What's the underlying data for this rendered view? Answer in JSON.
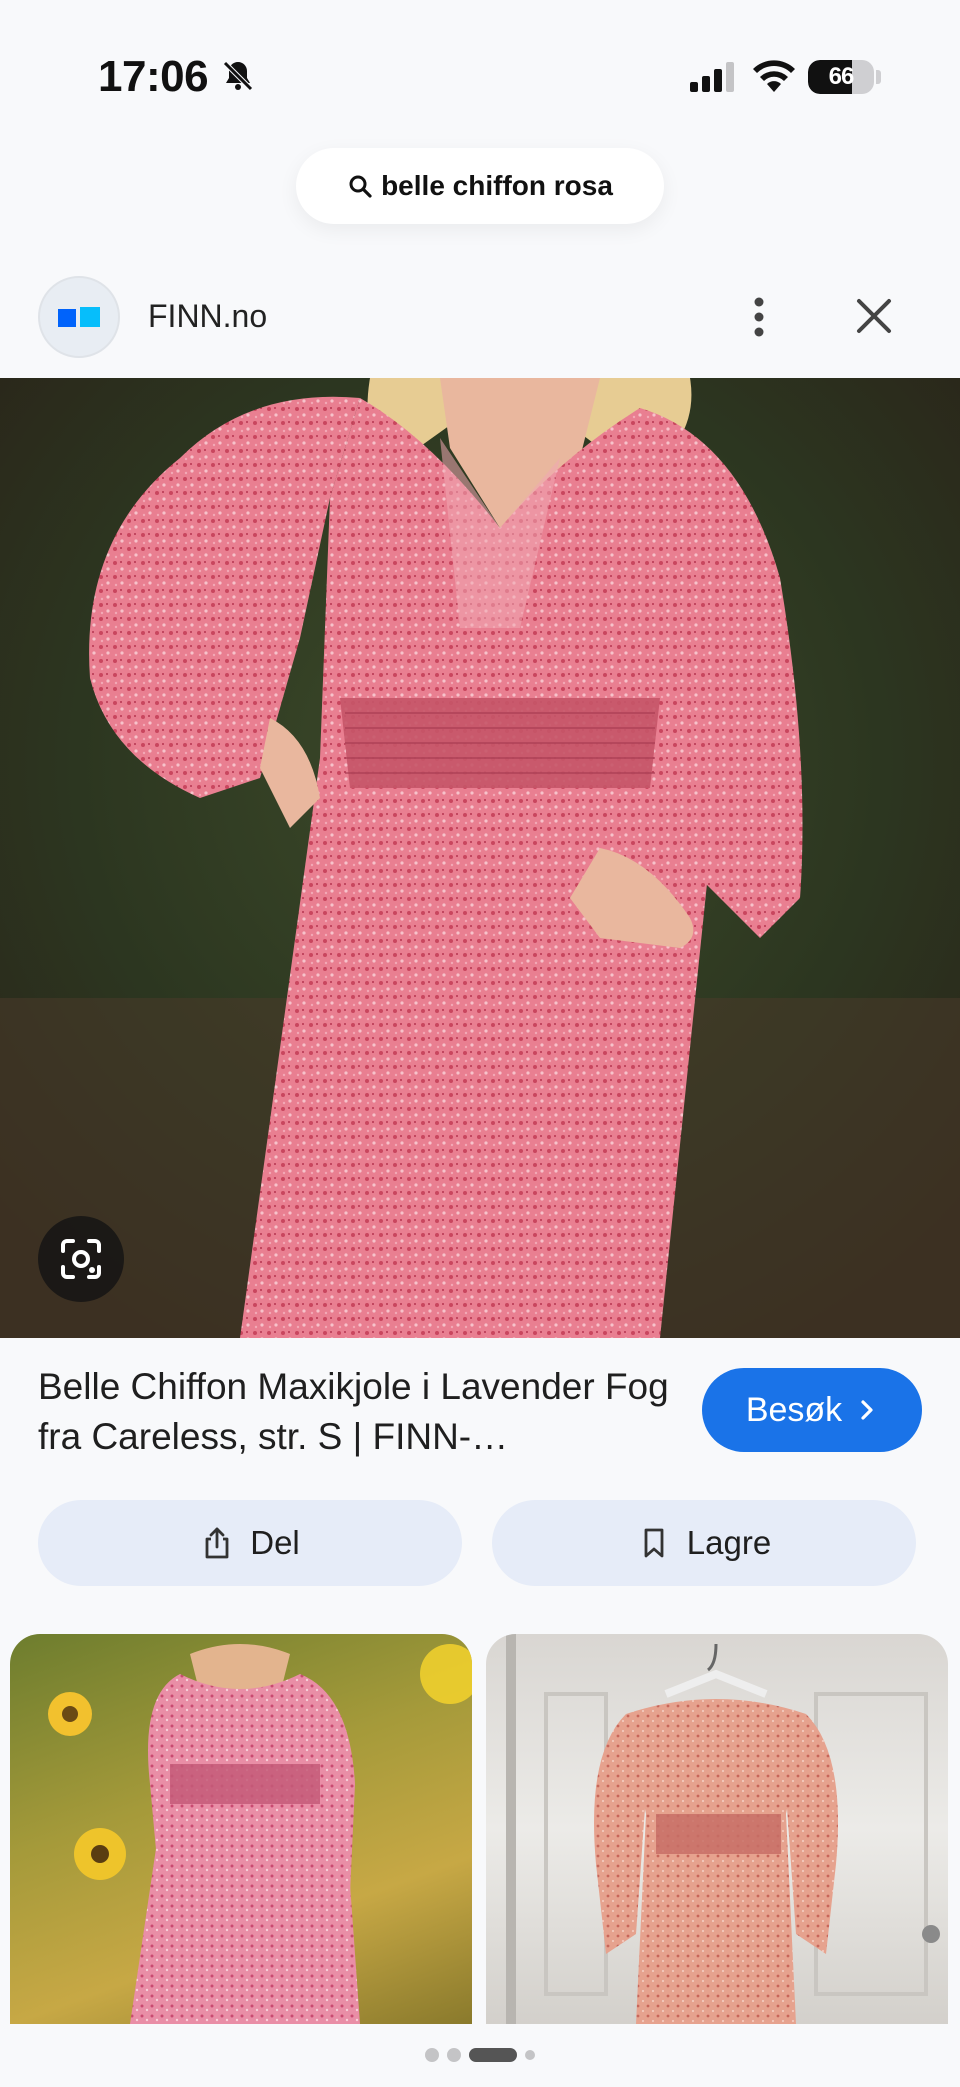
{
  "status_bar": {
    "time": "17:06",
    "battery_label": "66",
    "battery_level": 0.66,
    "icons": [
      "bell-off-icon",
      "cellular-signal-icon",
      "wifi-icon",
      "battery-icon"
    ]
  },
  "search": {
    "query": "belle chiffon rosa",
    "icon": "search-icon"
  },
  "source": {
    "name": "FINN.no",
    "logo_colors": [
      "#0063fb",
      "#06befb"
    ],
    "more_icon": "more-vert-icon",
    "close_icon": "close-icon"
  },
  "main_image": {
    "lens_icon": "google-lens-icon"
  },
  "result": {
    "title": "Belle Chiffon Maxikjole i Lavender Fog fra Careless, str. S | FINN-…",
    "visit_label": "Besøk",
    "visit_color": "#1a73e8"
  },
  "actions": {
    "share_label": "Del",
    "share_icon": "share-icon",
    "save_label": "Lagre",
    "save_icon": "bookmark-icon"
  },
  "related": {
    "count": 2
  },
  "pager": {
    "dots": 4,
    "active_index": 2
  }
}
